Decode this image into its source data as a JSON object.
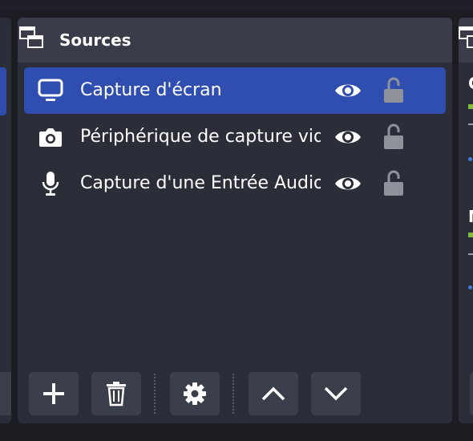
{
  "panel": {
    "title": "Sources"
  },
  "sources": [
    {
      "label": "Capture d'écran",
      "icon": "monitor-icon",
      "visible": true,
      "locked": false,
      "selected": true
    },
    {
      "label": "Périphérique de capture vidéo",
      "icon": "camera-icon",
      "visible": true,
      "locked": false,
      "selected": false
    },
    {
      "label": "Capture d'une Entrée Audio",
      "icon": "microphone-icon",
      "visible": true,
      "locked": false,
      "selected": false
    }
  ],
  "toolbar": {
    "buttons": [
      "add-icon",
      "trash-icon",
      "gear-icon",
      "chevron-up-icon",
      "chevron-down-icon"
    ]
  },
  "right_panel": {
    "lines": [
      "C",
      "M"
    ]
  },
  "colors": {
    "background": "#1c1d23",
    "panel": "#2b2e38",
    "header": "#3a3d49",
    "selection": "#2f4eaf",
    "button": "#3b3f4c",
    "lock": "#8e929b"
  }
}
